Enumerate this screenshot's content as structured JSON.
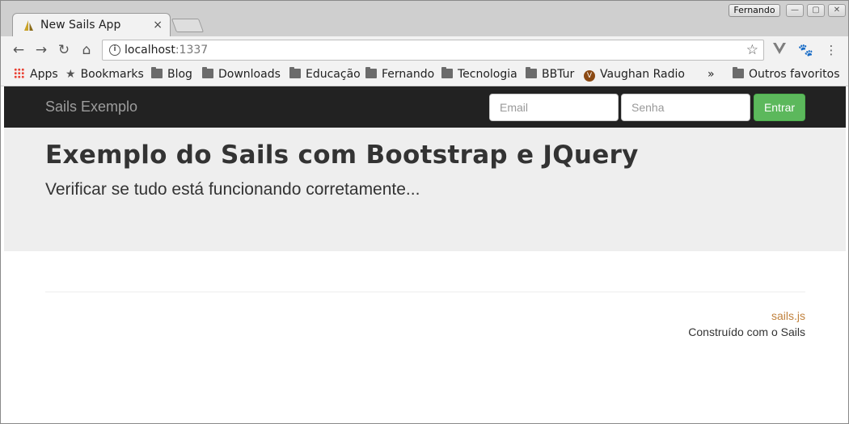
{
  "browser": {
    "tab": {
      "title": "New Sails App",
      "close_glyph": "×"
    },
    "profile": "Fernando",
    "window_controls": [
      "—",
      "▢",
      "✕"
    ],
    "address": {
      "host": "localhost",
      "port": ":1337"
    },
    "bookmarks": [
      {
        "label": "Apps",
        "icon": "apps-grid-icon"
      },
      {
        "label": "Bookmarks",
        "icon": "star-icon"
      },
      {
        "label": "Blog",
        "icon": "folder-icon"
      },
      {
        "label": "Downloads",
        "icon": "folder-icon"
      },
      {
        "label": "Educação",
        "icon": "folder-icon"
      },
      {
        "label": "Fernando",
        "icon": "folder-icon"
      },
      {
        "label": "Tecnologia",
        "icon": "folder-icon"
      },
      {
        "label": "BBTur",
        "icon": "folder-icon"
      },
      {
        "label": "Vaughan Radio",
        "icon": "vaughan-radio-icon"
      }
    ],
    "overflow": "»",
    "other_bookmarks": "Outros favoritos"
  },
  "page": {
    "navbar": {
      "brand": "Sails Exemplo",
      "email_placeholder": "Email",
      "password_placeholder": "Senha",
      "submit_label": "Entrar"
    },
    "jumbotron": {
      "title": "Exemplo do Sails com Bootstrap e JQuery",
      "lead": "Verificar se tudo está funcionando corretamente..."
    },
    "footer": {
      "link": "sails.js",
      "text": "Construído com o Sails"
    }
  },
  "colors": {
    "navbar_bg": "#222222",
    "jumbotron_bg": "#eeeeee",
    "success_button": "#5cb85c",
    "footer_link": "#c0813c"
  }
}
